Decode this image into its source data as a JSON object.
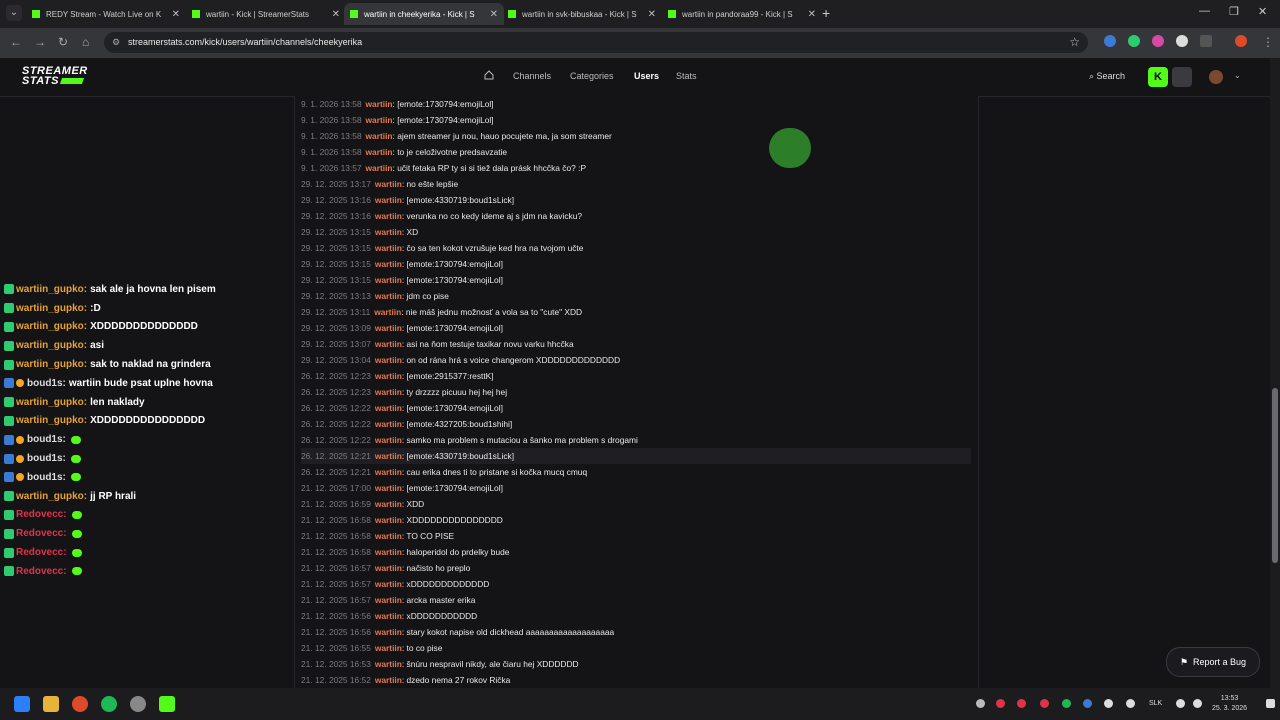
{
  "browser": {
    "tabs": [
      {
        "label": "REDY Stream - Watch Live on K",
        "active": false
      },
      {
        "label": "wartiin - Kick | StreamerStats",
        "active": false
      },
      {
        "label": "wartiin in cheekyerika - Kick | S",
        "active": true
      },
      {
        "label": "wartiin in svk-bibuskaa - Kick | S",
        "active": false
      },
      {
        "label": "wartiin in pandoraa99 - Kick | S",
        "active": false
      }
    ],
    "url": "streamerstats.com/kick/users/wartiin/channels/cheekyerika"
  },
  "header": {
    "logo_line1": "STREAMER",
    "logo_line2": "STATS",
    "nav": [
      "Channels",
      "Categories",
      "Users",
      "Stats"
    ],
    "active_nav": "Users",
    "search_label": "Search",
    "kick_label": "K"
  },
  "overlay_chat": [
    {
      "user": "wartiin_gupko:",
      "text": "sak ale ja hovna len pisem",
      "kind": "green"
    },
    {
      "user": "wartiin_gupko:",
      "text": ":D",
      "kind": "green"
    },
    {
      "user": "wartiin_gupko:",
      "text": "XDDDDDDDDDDDDDD",
      "kind": "green"
    },
    {
      "user": "wartiin_gupko:",
      "text": "asi",
      "kind": "green"
    },
    {
      "user": "wartiin_gupko:",
      "text": "sak to naklad na grindera",
      "kind": "green"
    },
    {
      "user": "boud1s:",
      "text": "wartiin bude psat uplne hovna",
      "kind": "blue"
    },
    {
      "user": "wartiin_gupko:",
      "text": "len naklady",
      "kind": "green"
    },
    {
      "user": "wartiin_gupko:",
      "text": "XDDDDDDDDDDDDDDD",
      "kind": "green"
    },
    {
      "user": "boud1s:",
      "text": "",
      "kind": "blue-emote"
    },
    {
      "user": "boud1s:",
      "text": "",
      "kind": "blue-emote"
    },
    {
      "user": "boud1s:",
      "text": "",
      "kind": "blue-emote"
    },
    {
      "user": "wartiin_gupko:",
      "text": "jj RP hrali",
      "kind": "green"
    },
    {
      "user": "Redovecc:",
      "text": "",
      "kind": "red-emote"
    },
    {
      "user": "Redovecc:",
      "text": "",
      "kind": "red-emote"
    },
    {
      "user": "Redovecc:",
      "text": "",
      "kind": "red-emote"
    },
    {
      "user": "Redovecc:",
      "text": "",
      "kind": "red-emote"
    }
  ],
  "log": [
    {
      "ts": "9. 1. 2026 13:58",
      "user": "wartiin",
      "msg": ": [emote:1730794:emojiLol]"
    },
    {
      "ts": "9. 1. 2026 13:58",
      "user": "wartiin",
      "msg": ": [emote:1730794:emojiLol]"
    },
    {
      "ts": "9. 1. 2026 13:58",
      "user": "wartiin",
      "msg": ": ajem streamer ju nou, hauo pocujete ma, ja som streamer"
    },
    {
      "ts": "9. 1. 2026 13:58",
      "user": "wartiin",
      "msg": ": to je celoživotne predsavzatie"
    },
    {
      "ts": "9. 1. 2026 13:57",
      "user": "wartiin",
      "msg": ": učit fetaka RP ty si si tiež dala prásk hhcčka čo? :P"
    },
    {
      "ts": "29. 12. 2025 13:17",
      "user": "wartiin",
      "msg": ": no ešte lepšie"
    },
    {
      "ts": "29. 12. 2025 13:16",
      "user": "wartiin",
      "msg": ": [emote:4330719:boud1sLick]"
    },
    {
      "ts": "29. 12. 2025 13:16",
      "user": "wartiin",
      "msg": ": verunka no co kedy ideme aj s jdm na kavicku?"
    },
    {
      "ts": "29. 12. 2025 13:15",
      "user": "wartiin",
      "msg": ": XD"
    },
    {
      "ts": "29. 12. 2025 13:15",
      "user": "wartiin",
      "msg": ": čo sa ten kokot vzrušuje ked hra na tvojom učte"
    },
    {
      "ts": "29. 12. 2025 13:15",
      "user": "wartiin",
      "msg": ": [emote:1730794:emojiLol]"
    },
    {
      "ts": "29. 12. 2025 13:15",
      "user": "wartiin",
      "msg": ": [emote:1730794:emojiLol]"
    },
    {
      "ts": "29. 12. 2025 13:13",
      "user": "wartiin",
      "msg": ": jdm co pise"
    },
    {
      "ts": "29. 12. 2025 13:11",
      "user": "wartiin",
      "msg": ": nie máš jednu možnosť a vola sa to \"cute\" XDD"
    },
    {
      "ts": "29. 12. 2025 13:09",
      "user": "wartiin",
      "msg": ": [emote:1730794:emojiLol]"
    },
    {
      "ts": "29. 12. 2025 13:07",
      "user": "wartiin",
      "msg": ": asi na ňom testuje taxikar novu varku hhcčka"
    },
    {
      "ts": "29. 12. 2025 13:04",
      "user": "wartiin",
      "msg": ": on od rána hrá s voice changerom XDDDDDDDDDDDDD"
    },
    {
      "ts": "26. 12. 2025 12:23",
      "user": "wartiin",
      "msg": ": [emote:2915377:resttK]"
    },
    {
      "ts": "26. 12. 2025 12:23",
      "user": "wartiin",
      "msg": ": ty drzzzz picuuu hej hej hej"
    },
    {
      "ts": "26. 12. 2025 12:22",
      "user": "wartiin",
      "msg": ": [emote:1730794:emojiLol]"
    },
    {
      "ts": "26. 12. 2025 12:22",
      "user": "wartiin",
      "msg": ": [emote:4327205:boud1shihi]"
    },
    {
      "ts": "26. 12. 2025 12:22",
      "user": "wartiin",
      "msg": ": samko ma problem s mutaciou a šanko ma problem s drogami"
    },
    {
      "ts": "26. 12. 2025 12:21",
      "user": "wartiin",
      "msg": ": [emote:4330719:boud1sLick]"
    },
    {
      "ts": "26. 12. 2025 12:21",
      "user": "wartiin",
      "msg": ": cau erika dnes ti to pristane si kočka mucq cmuq"
    },
    {
      "ts": "21. 12. 2025 17:00",
      "user": "wartiin",
      "msg": ": [emote:1730794:emojiLol]"
    },
    {
      "ts": "21. 12. 2025 16:59",
      "user": "wartiin",
      "msg": ": XDD"
    },
    {
      "ts": "21. 12. 2025 16:58",
      "user": "wartiin",
      "msg": ": XDDDDDDDDDDDDDDD"
    },
    {
      "ts": "21. 12. 2025 16:58",
      "user": "wartiin",
      "msg": ": TO CO PISE"
    },
    {
      "ts": "21. 12. 2025 16:58",
      "user": "wartiin",
      "msg": ": haloperidol do prdelky bude"
    },
    {
      "ts": "21. 12. 2025 16:57",
      "user": "wartiin",
      "msg": ": načisto ho preplo"
    },
    {
      "ts": "21. 12. 2025 16:57",
      "user": "wartiin",
      "msg": ": xDDDDDDDDDDDDD"
    },
    {
      "ts": "21. 12. 2025 16:57",
      "user": "wartiin",
      "msg": ": arcka master erika"
    },
    {
      "ts": "21. 12. 2025 16:56",
      "user": "wartiin",
      "msg": ": xDDDDDDDDDDD"
    },
    {
      "ts": "21. 12. 2025 16:56",
      "user": "wartiin",
      "msg": ": stary kokot napise old dickhead aaaaaaaaaaaaaaaaaaa"
    },
    {
      "ts": "21. 12. 2025 16:55",
      "user": "wartiin",
      "msg": ": to co pise"
    },
    {
      "ts": "21. 12. 2025 16:53",
      "user": "wartiin",
      "msg": ": šnúru nespravil nikdy, ale čiaru hej XDDDDDD"
    },
    {
      "ts": "21. 12. 2025 16:52",
      "user": "wartiin",
      "msg": ": dzedo nema 27 rokov Rička"
    }
  ],
  "report_bug_label": "Report a Bug",
  "taskbar": {
    "lang": "SLK",
    "time": "13:53",
    "date": "25. 3. 2026"
  },
  "colors": {
    "accent": "#53fc18",
    "username": "#e87a4b"
  }
}
